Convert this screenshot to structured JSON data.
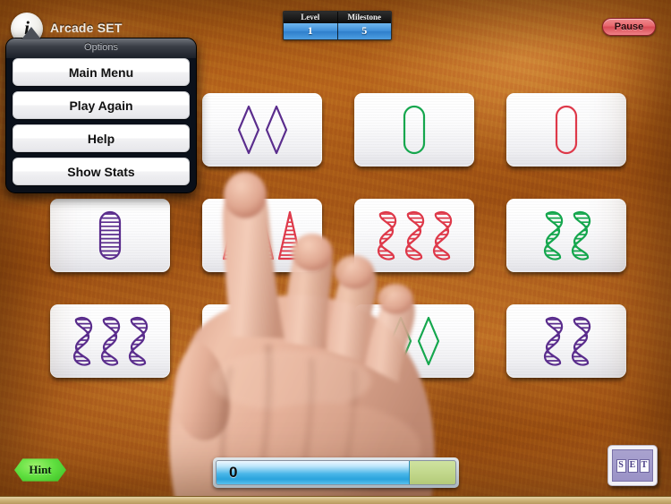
{
  "app": {
    "title": "Arcade SET",
    "info_icon_glyph": "i",
    "info_icon_name": "info-icon"
  },
  "header": {
    "stats": [
      {
        "label": "Level",
        "value": "1"
      },
      {
        "label": "Milestone",
        "value": "5"
      }
    ],
    "pause_label": "Pause"
  },
  "options_panel": {
    "title": "Options",
    "buttons": [
      {
        "label": "Main Menu",
        "name": "main-menu-button"
      },
      {
        "label": "Play Again",
        "name": "play-again-button"
      },
      {
        "label": "Help",
        "name": "help-button"
      },
      {
        "label": "Show Stats",
        "name": "show-stats-button"
      }
    ]
  },
  "bottom_bar": {
    "hint_label": "Hint",
    "score_value": "0",
    "score_fill_percent": 81,
    "logo_letters": [
      "S",
      "E",
      "T"
    ]
  },
  "colors": {
    "purple": "#5b2d8e",
    "green": "#15a84e",
    "red": "#e0394a",
    "accent_blue": "#3f8fd8",
    "hint_green": "#5fdf3f",
    "pause_red": "#e8696f",
    "wood": "#a85c16"
  },
  "cards": [
    {
      "id": "card-r1c1",
      "row": 1,
      "col": 1,
      "count": 0,
      "shape": "hidden",
      "color": "none",
      "fill": "none",
      "occluded_by": "options-panel"
    },
    {
      "id": "card-r1c2",
      "row": 1,
      "col": 2,
      "count": 2,
      "shape": "diamond",
      "color": "purple",
      "fill": "open"
    },
    {
      "id": "card-r1c3",
      "row": 1,
      "col": 3,
      "count": 1,
      "shape": "oval",
      "color": "green",
      "fill": "open"
    },
    {
      "id": "card-r1c4",
      "row": 1,
      "col": 4,
      "count": 1,
      "shape": "oval",
      "color": "red",
      "fill": "open"
    },
    {
      "id": "card-r2c1",
      "row": 2,
      "col": 1,
      "count": 1,
      "shape": "oval",
      "color": "purple",
      "fill": "striped"
    },
    {
      "id": "card-r2c2",
      "row": 2,
      "col": 2,
      "count": 3,
      "shape": "triangle",
      "color": "red",
      "fill": "striped"
    },
    {
      "id": "card-r2c3",
      "row": 2,
      "col": 3,
      "count": 3,
      "shape": "squiggle",
      "color": "red",
      "fill": "striped"
    },
    {
      "id": "card-r2c4",
      "row": 2,
      "col": 4,
      "count": 2,
      "shape": "squiggle",
      "color": "green",
      "fill": "striped"
    },
    {
      "id": "card-r3c1",
      "row": 3,
      "col": 1,
      "count": 3,
      "shape": "squiggle",
      "color": "purple",
      "fill": "striped"
    },
    {
      "id": "card-r3c2",
      "row": 3,
      "col": 2,
      "count": 0,
      "shape": "hidden",
      "color": "none",
      "fill": "none",
      "occluded_by": "hand"
    },
    {
      "id": "card-r3c3",
      "row": 3,
      "col": 3,
      "count": 2,
      "shape": "diamond",
      "color": "green",
      "fill": "open"
    },
    {
      "id": "card-r3c4",
      "row": 3,
      "col": 4,
      "count": 2,
      "shape": "squiggle",
      "color": "purple",
      "fill": "striped"
    }
  ]
}
